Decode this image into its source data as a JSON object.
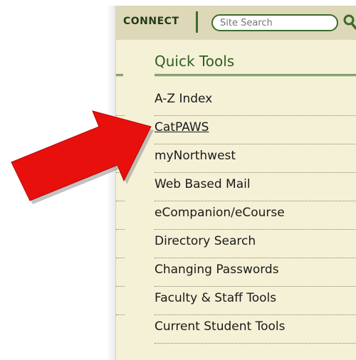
{
  "header": {
    "connect_label": "CONNECT",
    "search": {
      "placeholder": "Site Search",
      "value": ""
    },
    "search_icon": "search-icon"
  },
  "quick_tools": {
    "title": "Quick Tools",
    "items": [
      {
        "label": "A-Z Index",
        "active": false
      },
      {
        "label": "CatPAWS",
        "active": true
      },
      {
        "label": "myNorthwest",
        "active": false
      },
      {
        "label": "Web Based Mail",
        "active": false
      },
      {
        "label": "eCompanion/eCourse",
        "active": false
      },
      {
        "label": "Directory Search",
        "active": false
      },
      {
        "label": "Changing Passwords",
        "active": false
      },
      {
        "label": "Faculty & Staff Tools",
        "active": false
      },
      {
        "label": "Current Student Tools",
        "active": false
      }
    ]
  },
  "annotation": {
    "icon": "red-arrow-icon",
    "color": "#e8100c",
    "points_to": "CatPAWS"
  },
  "colors": {
    "panel_bg": "#f5f1d7",
    "topbar_bg": "#ddd8b8",
    "accent_green": "#2c5f1e",
    "arrow_red": "#e8100c"
  }
}
